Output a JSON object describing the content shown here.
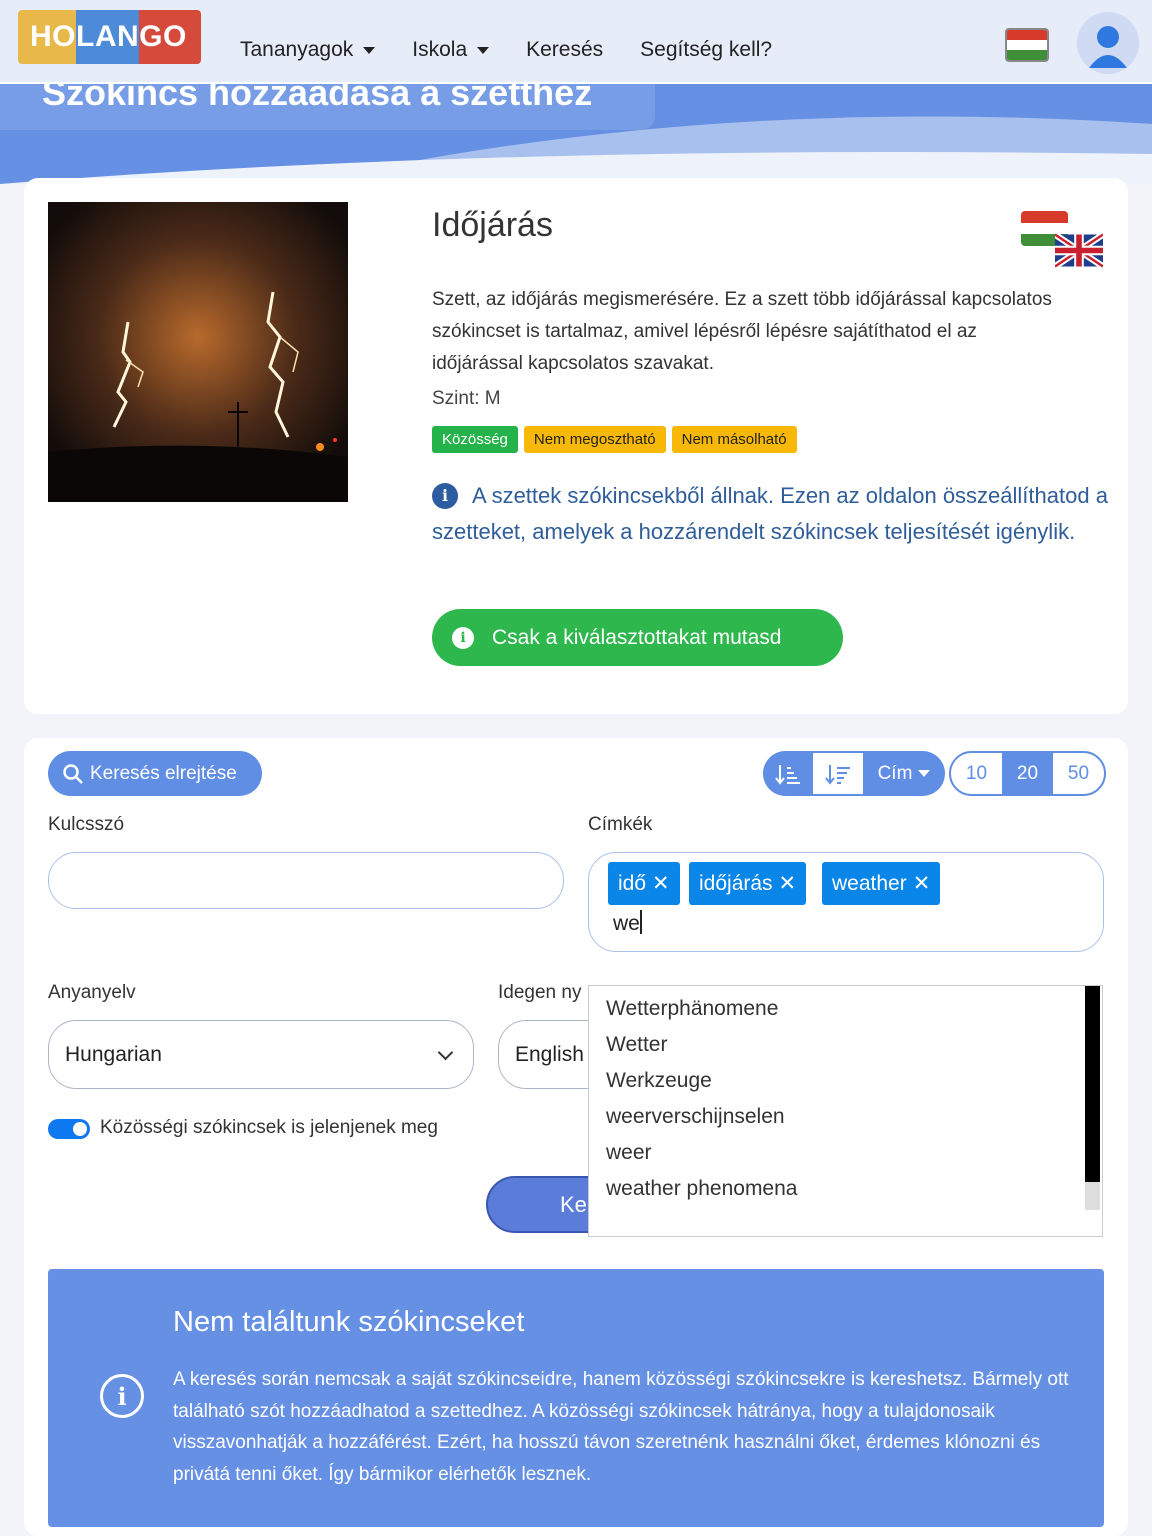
{
  "brand": {
    "logo_part1": "HO",
    "logo_part2": "LAN",
    "logo_part3": "GO"
  },
  "nav": {
    "items": [
      {
        "label": "Tananyagok",
        "dropdown": true
      },
      {
        "label": "Iskola",
        "dropdown": true
      },
      {
        "label": "Keresés",
        "dropdown": false
      },
      {
        "label": "Segítség kell?",
        "dropdown": false
      }
    ],
    "language_flag": "flag-hungary-icon",
    "avatar_icon": "user-icon"
  },
  "page": {
    "title": "Szókincs hozzáadása a szetthez"
  },
  "set": {
    "title": "Időjárás",
    "description": "Szett, az időjárás megismerésére. Ez a szett több időjárással kapcsolatos szókincset is tartalmaz, amivel lépésről lépésre sajátíthatod el az időjárással kapcsolatos szavakat.",
    "level": "Szint: M",
    "badges": [
      "Közösség",
      "Nem megosztható",
      "Nem másolható"
    ],
    "info": "A szettek szókincsekből állnak. Ezen az oldalon összeállíthatod a szetteket, amelyek a hozzárendelt szókincsek teljesítését igénylik.",
    "show_selected_button": "Csak a kiválasztottakat mutasd"
  },
  "filters": {
    "hide_search_button": "Keresés elrejtése",
    "sort_label": "Cím",
    "page_sizes": [
      "10",
      "20",
      "50"
    ],
    "active_page_size": "20",
    "keyword_label": "Kulcsszó",
    "keyword_value": "",
    "tags_label": "Címkék",
    "tags": [
      "idő",
      "időjárás",
      "weather"
    ],
    "tag_input_value": "we",
    "native_label": "Anyanyelv",
    "native_value": "Hungarian",
    "foreign_label": "Idegen ny",
    "foreign_value": "English",
    "community_toggle_label": "Közösségi szókincsek is jelenjenek meg",
    "community_toggle_on": true,
    "search_button": "Ke"
  },
  "autocomplete": {
    "options": [
      "Wetterphänomene",
      "Wetter",
      "Werkzeuge",
      "weerverschijnselen",
      "weer",
      "weather phenomena"
    ]
  },
  "alert": {
    "title": "Nem találtunk szókincseket",
    "body": "A keresés során nemcsak a saját szókincseidre, hanem közösségi szókincsekre is kereshetsz. Bármely ott található szót hozzáadhatod a szettedhez. A közösségi szókincsek hátránya, hogy a tulajdonosaik visszavonhatják a hozzáférést. Ezért, ha hosszú távon szeretnénk használni őket, érdemes klónozni és privátá tenni őket. Így bármikor elérhetők lesznek."
  },
  "colors": {
    "accent": "#5f8ee4",
    "success": "#2db74c",
    "tag": "#0a85e8",
    "warning": "#f8b808"
  }
}
